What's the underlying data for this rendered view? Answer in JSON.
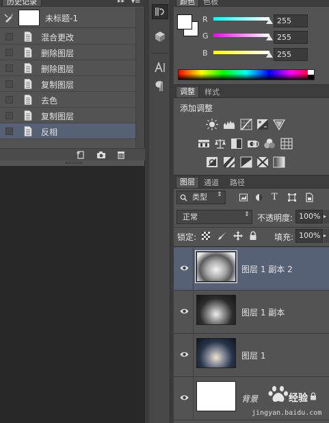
{
  "history": {
    "tab_label": "历史记录",
    "snapshot_name": "未标题-1",
    "items": [
      {
        "label": "混合更改"
      },
      {
        "label": "删除图层"
      },
      {
        "label": "删除图层"
      },
      {
        "label": "复制图层"
      },
      {
        "label": "去色"
      },
      {
        "label": "复制图层"
      },
      {
        "label": "反相"
      }
    ],
    "selected_index": 6
  },
  "color": {
    "tabs": [
      "颜色",
      "色板"
    ],
    "channels": [
      {
        "label": "R",
        "value": "255"
      },
      {
        "label": "G",
        "value": "255"
      },
      {
        "label": "B",
        "value": "255"
      }
    ],
    "foreground": "#ffffff",
    "background": "#ffffff"
  },
  "adjustments": {
    "tabs": [
      "调整",
      "样式"
    ],
    "title": "添加调整"
  },
  "layers": {
    "tabs": [
      "图层",
      "通道",
      "路径"
    ],
    "filter_kind": "类型",
    "blend_mode": "正常",
    "opacity_label": "不透明度:",
    "opacity_value": "100%",
    "lock_label": "锁定:",
    "fill_label": "填充:",
    "fill_value": "100%",
    "items": [
      {
        "name": "图层 1 副本 2",
        "selected": true
      },
      {
        "name": "图层 1 副本",
        "selected": false
      },
      {
        "name": "图层 1",
        "selected": false
      },
      {
        "name": "背景",
        "selected": false
      }
    ]
  },
  "watermark": {
    "brand": "Baidu经验",
    "url": "jingyan.baidu.com"
  },
  "colors": {
    "panel": "#535353",
    "selection": "#566175",
    "field": "#3b3b3b"
  }
}
